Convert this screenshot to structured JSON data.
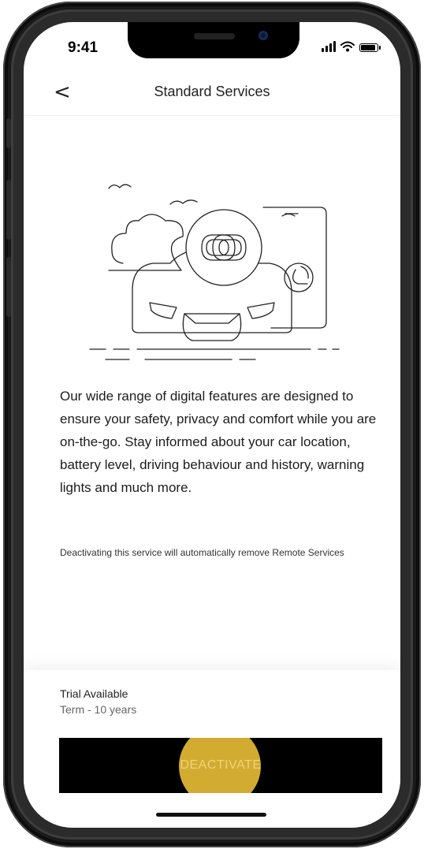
{
  "status_bar": {
    "time": "9:41"
  },
  "header": {
    "back_icon": "chevron-left-icon",
    "back_glyph": "<",
    "title": "Standard Services"
  },
  "main": {
    "illustration": "car-connected-phone-illustration",
    "description": "Our wide range of digital features are designed to ensure your safety, privacy and comfort while you are on-the-go. Stay informed about your car location, battery level, driving behaviour and history, warning lights and much more.",
    "note": "Deactivating this service will automatically remove Remote Services"
  },
  "footer": {
    "trial_label": "Trial Available",
    "term_label": "Term - 10 years",
    "deactivate_label": "DEACTIVATE"
  },
  "colors": {
    "button_bg": "#000000",
    "button_text": "#f1d27a",
    "tap_highlight": "#ffd23c"
  }
}
